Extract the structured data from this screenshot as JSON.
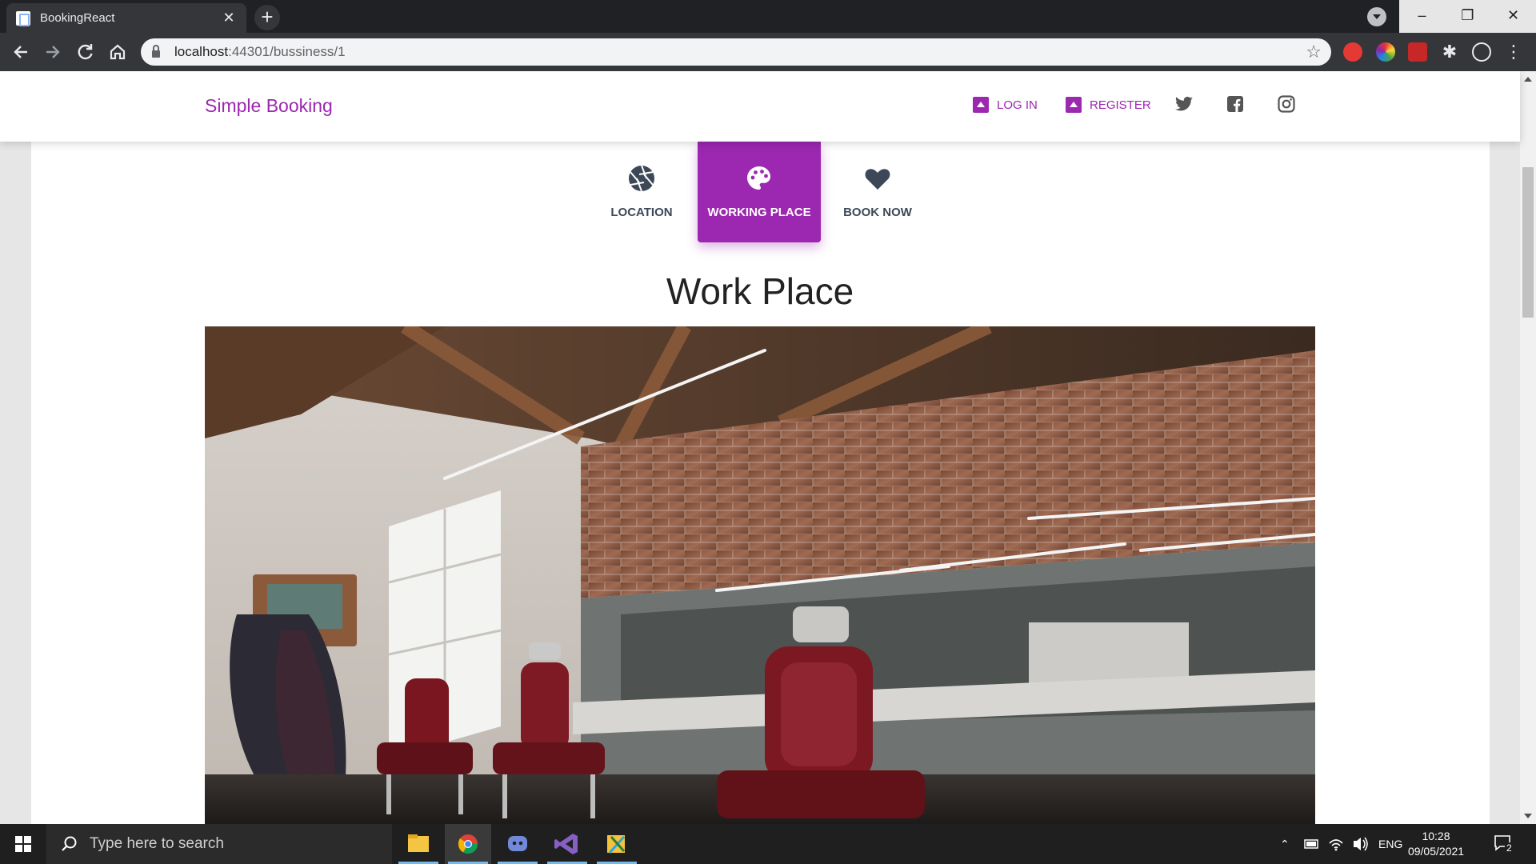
{
  "browser": {
    "tab_title": "BookingReact",
    "tab_close": "✕",
    "new_tab": "+",
    "url_host": "localhost",
    "url_rest": ":44301/bussiness/1",
    "window_controls": {
      "minimize": "–",
      "maximize": "❐",
      "close": "✕"
    }
  },
  "site": {
    "brand": "Simple Booking",
    "nav": {
      "login": "LOG IN",
      "register": "REGISTER"
    },
    "social_icons": [
      "twitter-icon",
      "facebook-icon",
      "instagram-icon"
    ],
    "accent_color": "#9c27b0"
  },
  "pills": {
    "location": "LOCATION",
    "working_place": "WORKING PLACE",
    "book_now": "BOOK NOW",
    "active": "working_place"
  },
  "main": {
    "title": "Work Place"
  },
  "taskbar": {
    "search_placeholder": "Type here to search",
    "language": "ENG",
    "time": "10:28",
    "date": "09/05/2021",
    "notification_count": "2"
  }
}
